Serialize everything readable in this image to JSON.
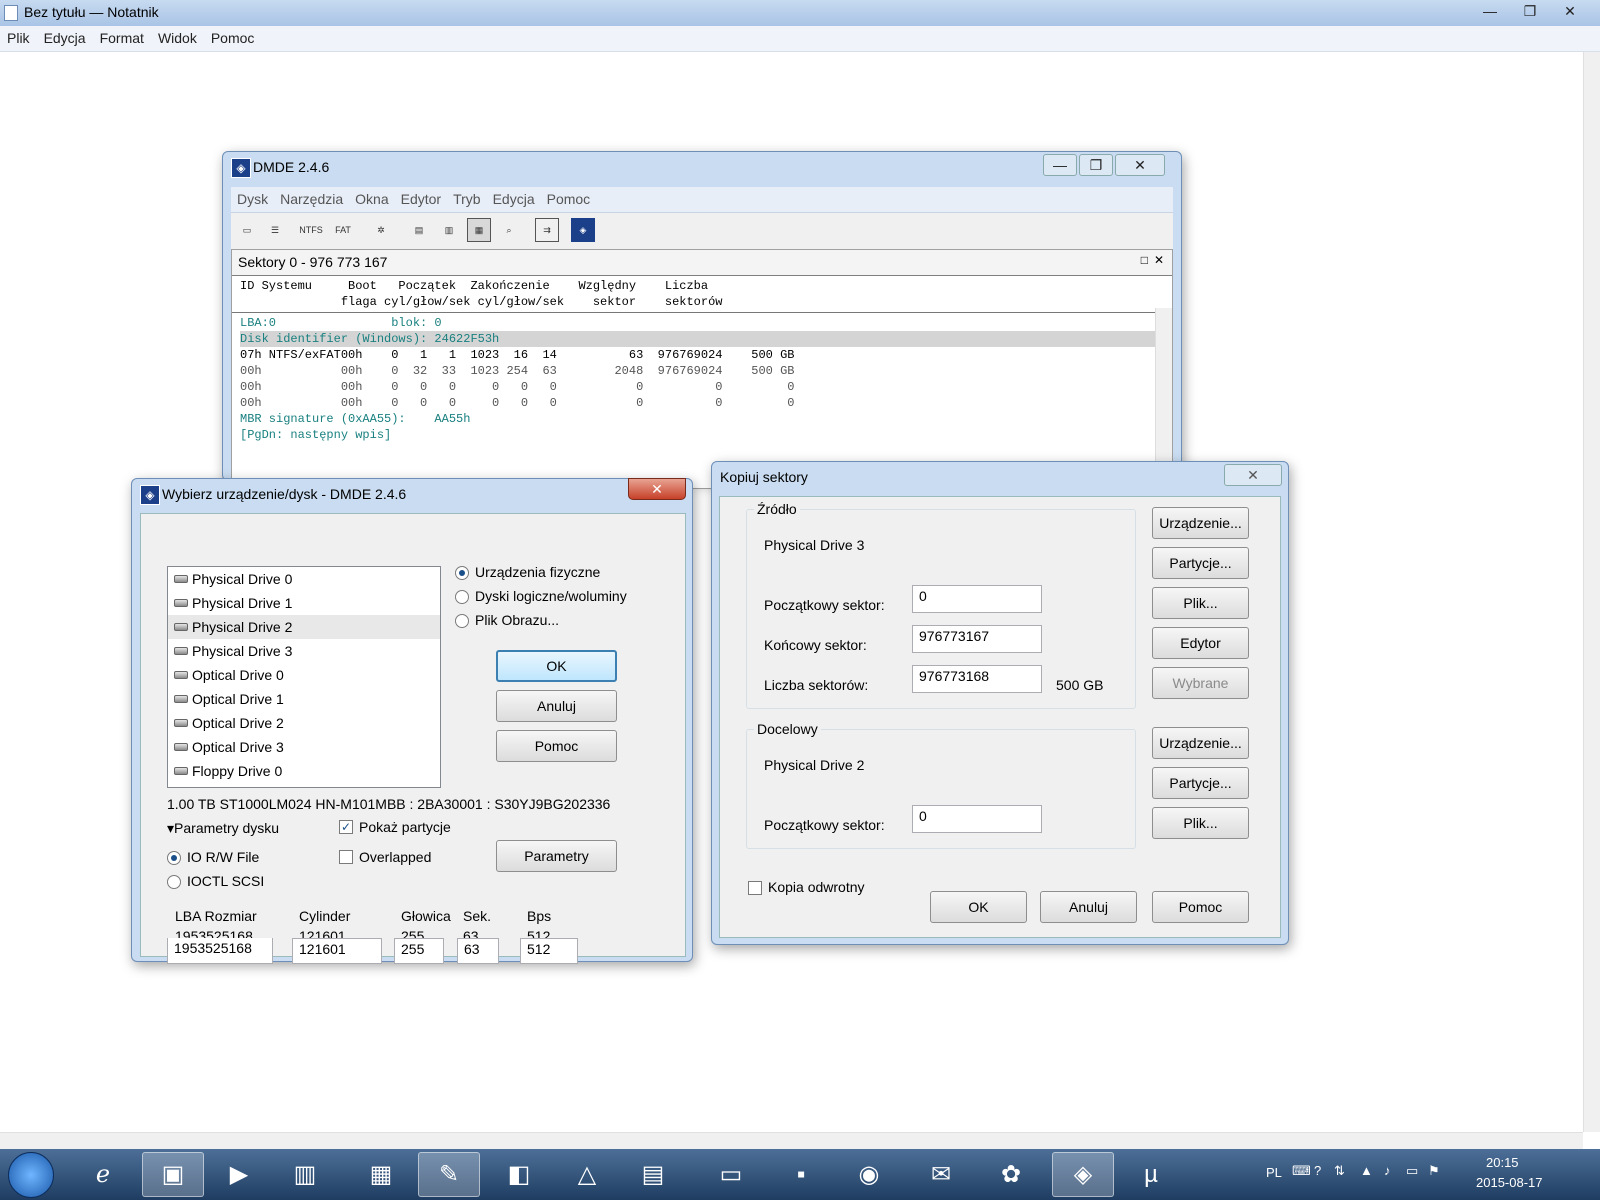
{
  "notepad": {
    "title": "Bez tytułu — Notatnik",
    "menu": [
      "Plik",
      "Edycja",
      "Format",
      "Widok",
      "Pomoc"
    ]
  },
  "window_controls": {
    "minimize": "—",
    "maximize": "❐",
    "close": "✕"
  },
  "dmde": {
    "title": "DMDE 2.4.6",
    "menu": [
      "Dysk",
      "Narzędzia",
      "Okna",
      "Edytor",
      "Tryb",
      "Edycja",
      "Pomoc"
    ],
    "toolbar": {
      "ntfs": "NTFS",
      "fat": "FAT"
    },
    "panel_title": "Sektory 0 - 976 773 167",
    "header1": "ID Systemu     Boot   Początek  Zakończenie    Względny    Liczba",
    "header2": "              flaga cyl/głow/sek cyl/głow/sek    sektor    sektorów",
    "lines": [
      "LBA:0                blok: 0",
      "Disk identifier (Windows): 24622F53h",
      "07h NTFS/exFAT00h    0   1   1  1023  16  14          63  976769024    500 GB",
      "00h           00h    0  32  33  1023 254  63        2048  976769024    500 GB",
      "00h           00h    0   0   0     0   0   0           0          0         0",
      "00h           00h    0   0   0     0   0   0           0          0         0",
      "MBR signature (0xAA55):    AA55h",
      "[PgDn: następny wpis]"
    ]
  },
  "wybierz": {
    "title": "Wybierz urządzenie/dysk - DMDE 2.4.6",
    "drives": [
      "Physical Drive 0",
      "Physical Drive 1",
      "Physical Drive 2",
      "Physical Drive 3",
      "Optical Drive 0",
      "Optical Drive 1",
      "Optical Drive 2",
      "Optical Drive 3",
      "Floppy Drive 0"
    ],
    "selected_drive": "Physical Drive 2",
    "radio_physical": "Urządzenia fizyczne",
    "radio_logical": "Dyski logiczne/woluminy",
    "radio_image": "Plik Obrazu...",
    "ok": "OK",
    "cancel": "Anuluj",
    "help": "Pomoc",
    "disk_info": "1.00 TB ST1000LM024 HN-M101MBB : 2BA30001 : S30YJ9BG202336",
    "params_label": "▾Parametry dysku",
    "show_partitions": "Pokaż partycje",
    "overlapped": "Overlapped",
    "io_rw": "IO R/W File",
    "ioctl": "IOCTL SCSI",
    "params_button": "Parametry",
    "col_lba": "LBA Rozmiar",
    "col_cyl": "Cylinder",
    "col_head": "Głowica",
    "col_sek": "Sek.",
    "col_bps": "Bps",
    "val_lba": "1953525168",
    "val_cyl": "121601",
    "val_head": "255",
    "val_sek": "63",
    "val_bps": "512",
    "in_lba": "1953525168",
    "in_cyl": "121601",
    "in_head": "255",
    "in_sek": "63",
    "in_bps": "512"
  },
  "kopiuj": {
    "title": "Kopiuj sektory",
    "source_label": "Źródło",
    "source_drive": "Physical Drive 3",
    "start_label": "Początkowy sektor:",
    "start_value": "0",
    "end_label": "Końcowy sektor:",
    "end_value": "976773167",
    "count_label": "Liczba sektorów:",
    "count_value": "976773168",
    "count_size": "500 GB",
    "btn_device": "Urządzenie...",
    "btn_partitions": "Partycje...",
    "btn_file": "Plik...",
    "btn_editor": "Edytor",
    "btn_selected": "Wybrane",
    "target_label": "Docelowy",
    "target_drive": "Physical Drive 2",
    "target_start_label": "Początkowy sektor:",
    "target_start_value": "0",
    "btn_device2": "Urządzenie...",
    "btn_partitions2": "Partycje...",
    "btn_file2": "Plik...",
    "reverse": "Kopia odwrotny",
    "ok": "OK",
    "cancel": "Anuluj",
    "help": "Pomoc"
  },
  "taskbar": {
    "lang": "PL",
    "time": "20:15",
    "date": "2015-08-17"
  }
}
